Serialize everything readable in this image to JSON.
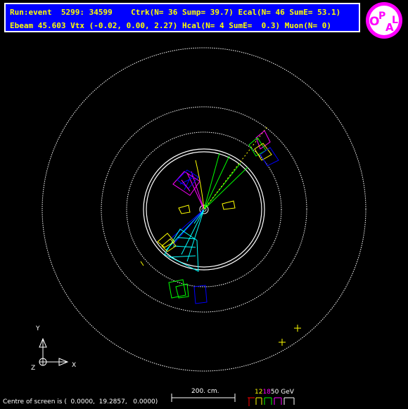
{
  "header": {
    "line1": "Run:event  5299: 34599    Ctrk(N= 36 Sump= 39.7) Ecal(N= 46 SumE= 53.1)",
    "line2": "Ebeam 45.603 Vtx (-0.02, 0.00, 2.27) Hcal(N= 4 SumE=  0.3) Muon(N= 0)"
  },
  "logo": {
    "text": "OPAL",
    "letters": [
      "O",
      "P",
      "A",
      "L"
    ]
  },
  "axes": {
    "y": "Y",
    "x": "X",
    "z": "Z"
  },
  "scale": {
    "label": "200. cm."
  },
  "energy_scale": {
    "v1": "12",
    "v2": "18",
    "v3": "50",
    "unit": "GeV"
  },
  "footer": {
    "centre": "Centre of screen is (  0.0000,  19.2857,   0.0000)"
  },
  "colors": {
    "background": "#000000",
    "header_bg": "#0000ff",
    "header_text": "#ffff00",
    "logo": "#ff00ff",
    "track_yellow": "#ffff00",
    "track_green": "#00ff00",
    "track_cyan": "#00ffff",
    "track_blue": "#0000ff",
    "track_magenta": "#ff00ff"
  }
}
